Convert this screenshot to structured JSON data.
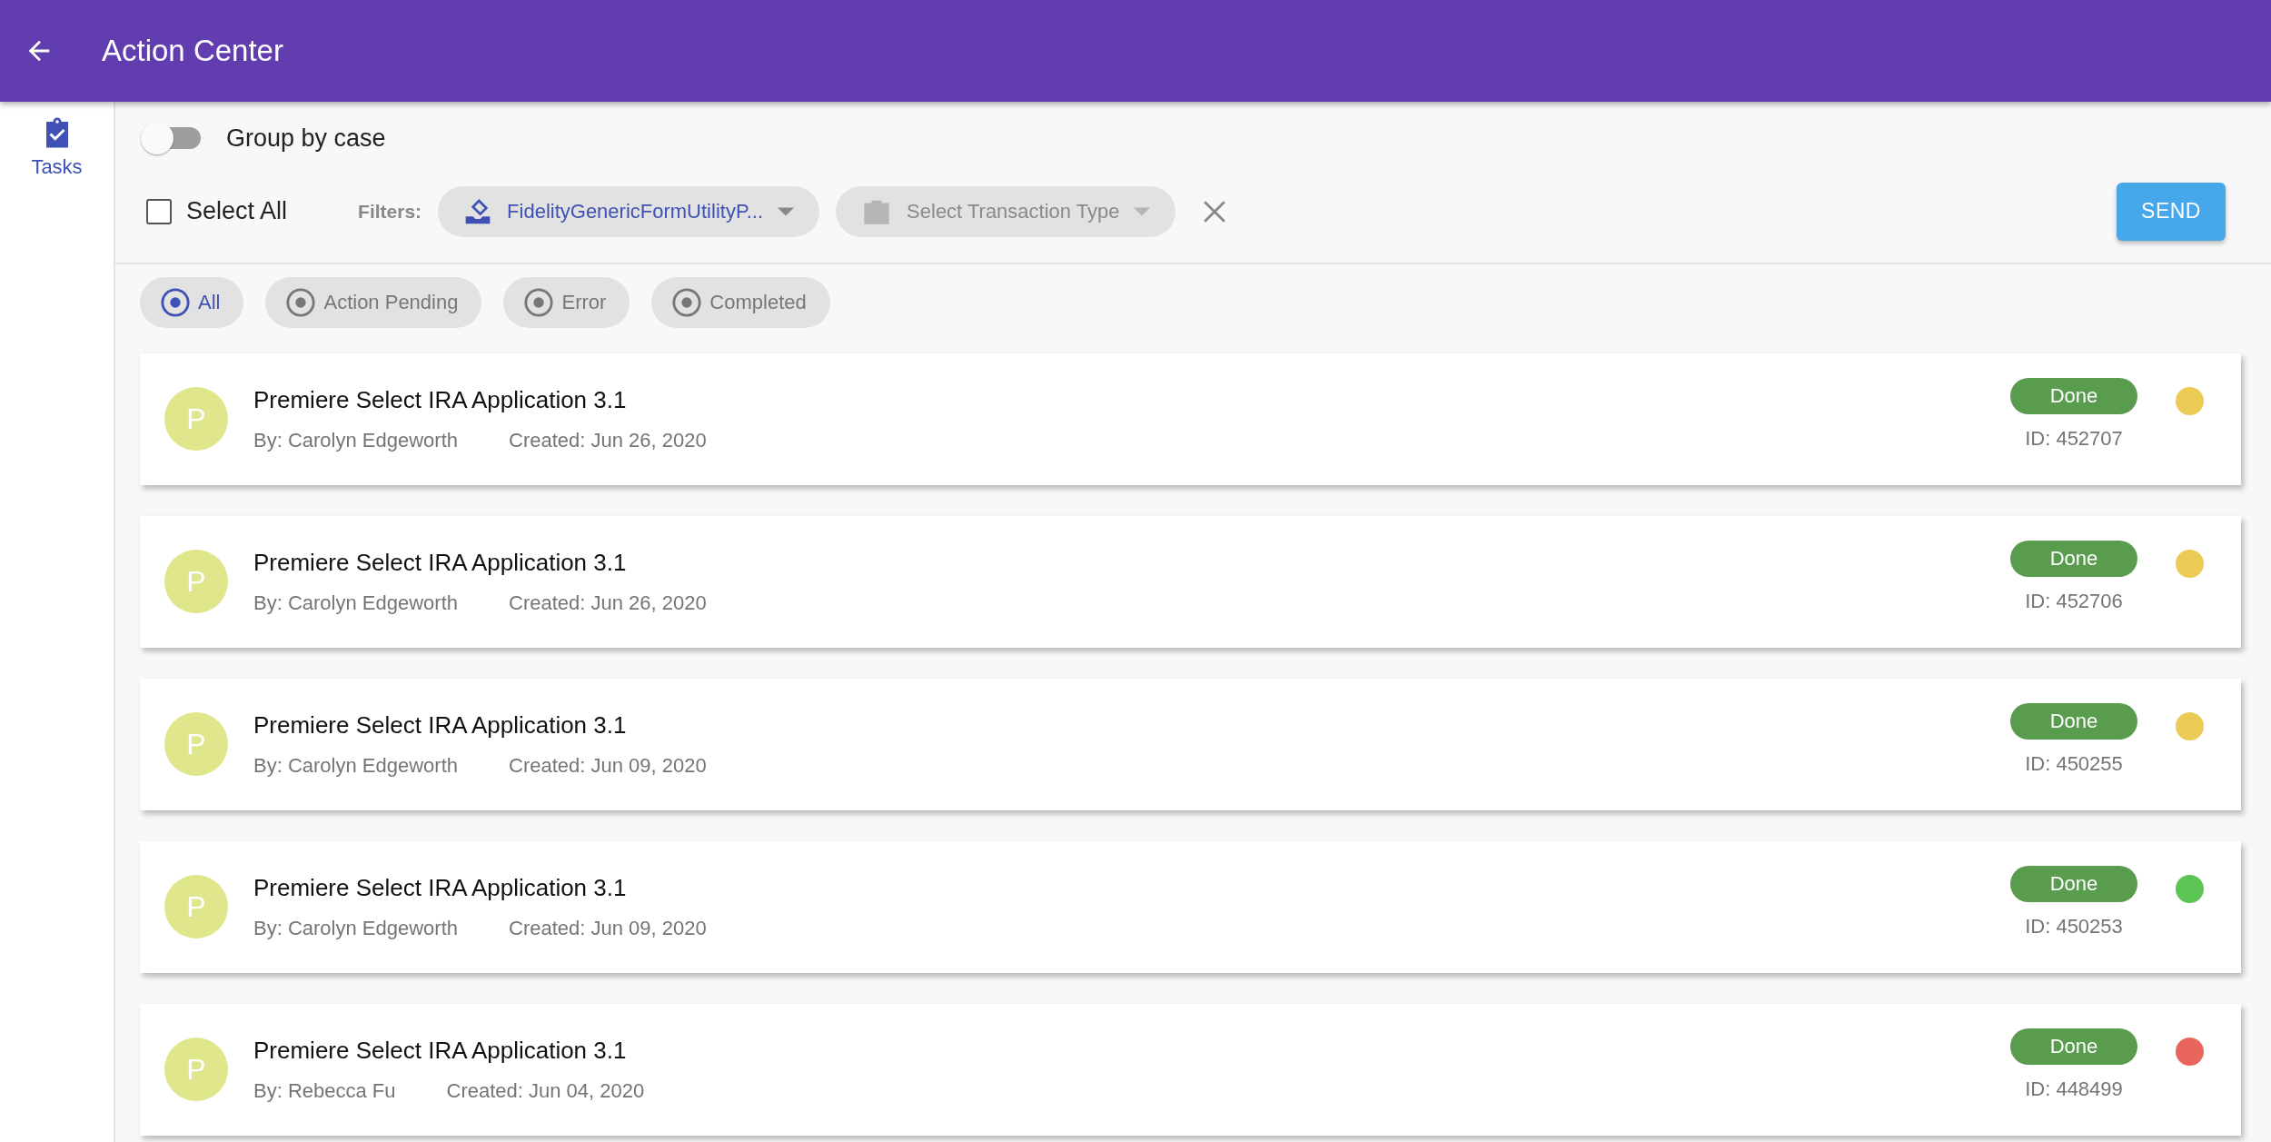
{
  "app_bar": {
    "title": "Action Center"
  },
  "sidebar": {
    "items": [
      {
        "label": "Tasks",
        "selected": true
      }
    ]
  },
  "group_by_case": {
    "label": "Group by case",
    "on": false
  },
  "select_all": {
    "label": "Select All",
    "checked": false
  },
  "filters": {
    "label": "Filters:",
    "fields": [
      {
        "kind": "form",
        "value": "FidelityGenericFormUtilityP..."
      },
      {
        "kind": "transaction",
        "placeholder": "Select Transaction Type"
      }
    ]
  },
  "send_button": "SEND",
  "status_tabs": [
    {
      "label": "All",
      "selected": true
    },
    {
      "label": "Action Pending",
      "selected": false
    },
    {
      "label": "Error",
      "selected": false
    },
    {
      "label": "Completed",
      "selected": false
    }
  ],
  "tasks": [
    {
      "avatar": "P",
      "title": "Premiere Select IRA Application 3.1",
      "by": "By: Carolyn Edgeworth",
      "created": "Created: Jun 26, 2020",
      "status": "Done",
      "id": "ID: 452707",
      "color": "#ecca56"
    },
    {
      "avatar": "P",
      "title": "Premiere Select IRA Application 3.1",
      "by": "By: Carolyn Edgeworth",
      "created": "Created: Jun 26, 2020",
      "status": "Done",
      "id": "ID: 452706",
      "color": "#ecca56"
    },
    {
      "avatar": "P",
      "title": "Premiere Select IRA Application 3.1",
      "by": "By: Carolyn Edgeworth",
      "created": "Created: Jun 09, 2020",
      "status": "Done",
      "id": "ID: 450255",
      "color": "#ecca56"
    },
    {
      "avatar": "P",
      "title": "Premiere Select IRA Application 3.1",
      "by": "By: Carolyn Edgeworth",
      "created": "Created: Jun 09, 2020",
      "status": "Done",
      "id": "ID: 450253",
      "color": "#5cc454"
    },
    {
      "avatar": "P",
      "title": "Premiere Select IRA Application 3.1",
      "by": "By: Rebecca Fu",
      "created": "Created: Jun 04, 2020",
      "status": "Done",
      "id": "ID: 448499",
      "color": "#e8665c"
    }
  ]
}
